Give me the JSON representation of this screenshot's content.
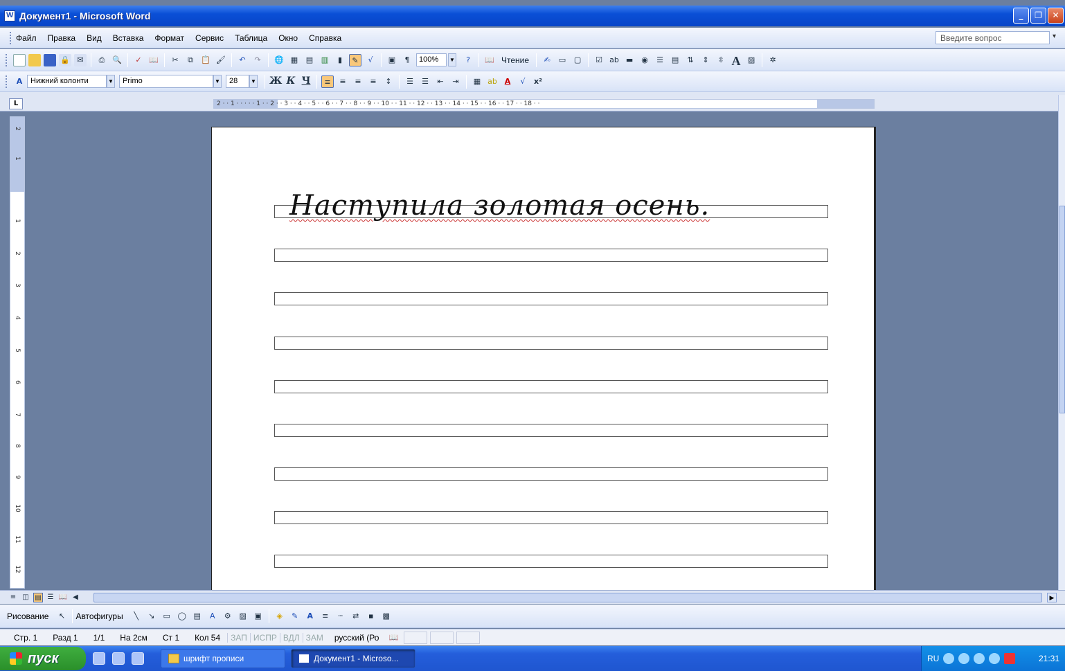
{
  "window": {
    "title": "Документ1 - Microsoft Word"
  },
  "menu": {
    "items": [
      "Файл",
      "Правка",
      "Вид",
      "Вставка",
      "Формат",
      "Сервис",
      "Таблица",
      "Окно",
      "Справка"
    ],
    "ask_placeholder": "Введите вопрос"
  },
  "toolbar": {
    "zoom": "100%",
    "reading_label": "Чтение"
  },
  "formatting": {
    "style": "Нижний колонти",
    "font": "Primo",
    "size": "28",
    "bold": "Ж",
    "italic": "К",
    "underline": "Ч"
  },
  "ruler": {
    "h_ticks": "2 · · 1 · · ⋅ · · 1 · · 2 · · 3 · · 4 · · 5 · · 6 · · 7 · · 8 · · 9 · · 10 · · 11 · · 12 · · 13 · · 14 · · 15 · · 16 · · 17 · · 18 · ·",
    "v_ticks": [
      "2",
      "1",
      "1",
      "2",
      "3",
      "4",
      "5",
      "6",
      "7",
      "8",
      "9",
      "10",
      "11",
      "12"
    ]
  },
  "document": {
    "text": "Наступила золотая осень.",
    "line_count": 9
  },
  "drawing": {
    "draw_label": "Рисование",
    "autoshapes_label": "Автофигуры"
  },
  "status": {
    "page": "Стр. 1",
    "section": "Разд 1",
    "pages": "1/1",
    "at": "На 2см",
    "line": "Ст 1",
    "col": "Кол 54",
    "rec": "ЗАП",
    "trk": "ИСПР",
    "ext": "ВДЛ",
    "ovr": "ЗАМ",
    "lang": "русский (Ро"
  },
  "taskbar": {
    "start": "пуск",
    "tasks": [
      "шрифт прописи",
      "Документ1 - Microso..."
    ],
    "lang": "RU",
    "clock": "21:31"
  }
}
